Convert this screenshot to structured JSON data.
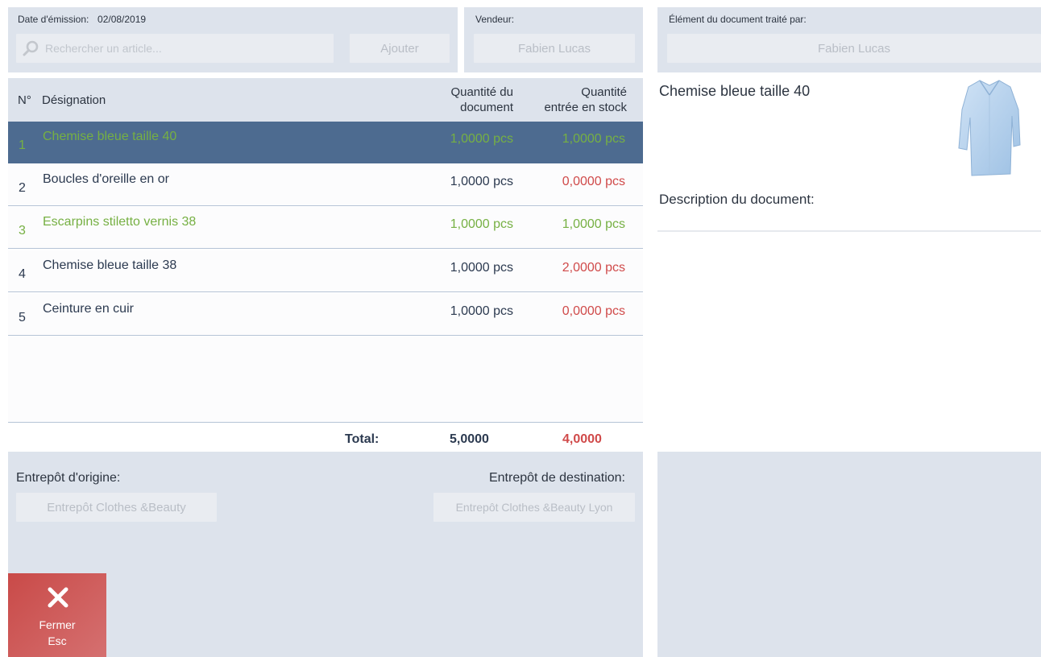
{
  "header": {
    "date_label": "Date d'émission:",
    "date_value": "02/08/2019",
    "search_placeholder": "Rechercher un article...",
    "add_label": "Ajouter",
    "seller_label": "Vendeur:",
    "seller_value": "Fabien Lucas",
    "processed_label": "Élément du document traité par:",
    "processed_value": "Fabien Lucas"
  },
  "table": {
    "col_num": "N°",
    "col_name": "Désignation",
    "col_qty_doc_1": "Quantité du",
    "col_qty_doc_2": "document",
    "col_qty_stock_1": "Quantité",
    "col_qty_stock_2": "entrée en stock",
    "rows": [
      {
        "num": "1",
        "name": "Chemise bleue taille 40",
        "qty_doc": "1,0000 pcs",
        "qty_stock": "1,0000 pcs"
      },
      {
        "num": "2",
        "name": "Boucles d'oreille en or",
        "qty_doc": "1,0000 pcs",
        "qty_stock": "0,0000 pcs"
      },
      {
        "num": "3",
        "name": "Escarpins stiletto vernis 38",
        "qty_doc": "1,0000 pcs",
        "qty_stock": "1,0000 pcs"
      },
      {
        "num": "4",
        "name": "Chemise bleue taille 38",
        "qty_doc": "1,0000 pcs",
        "qty_stock": "2,0000 pcs"
      },
      {
        "num": "5",
        "name": "Ceinture en cuir",
        "qty_doc": "1,0000 pcs",
        "qty_stock": "0,0000 pcs"
      }
    ],
    "total_label": "Total:",
    "total_doc": "5,0000",
    "total_stock": "4,0000"
  },
  "warehouse": {
    "origin_label": "Entrepôt d'origine:",
    "origin_value": "Entrepôt Clothes &Beauty",
    "dest_label": "Entrepôt de destination:",
    "dest_value": "Entrepôt Clothes &Beauty Lyon"
  },
  "close_button": {
    "label": "Fermer",
    "shortcut": "Esc"
  },
  "details": {
    "item_title": "Chemise bleue taille 40",
    "description_label": "Description du document:"
  },
  "colors": {
    "panel_bg": "#dde3ec",
    "selected_row": "#4d6b90",
    "green": "#76b043",
    "red": "#d04a4a",
    "close_red": "#c94a48"
  }
}
